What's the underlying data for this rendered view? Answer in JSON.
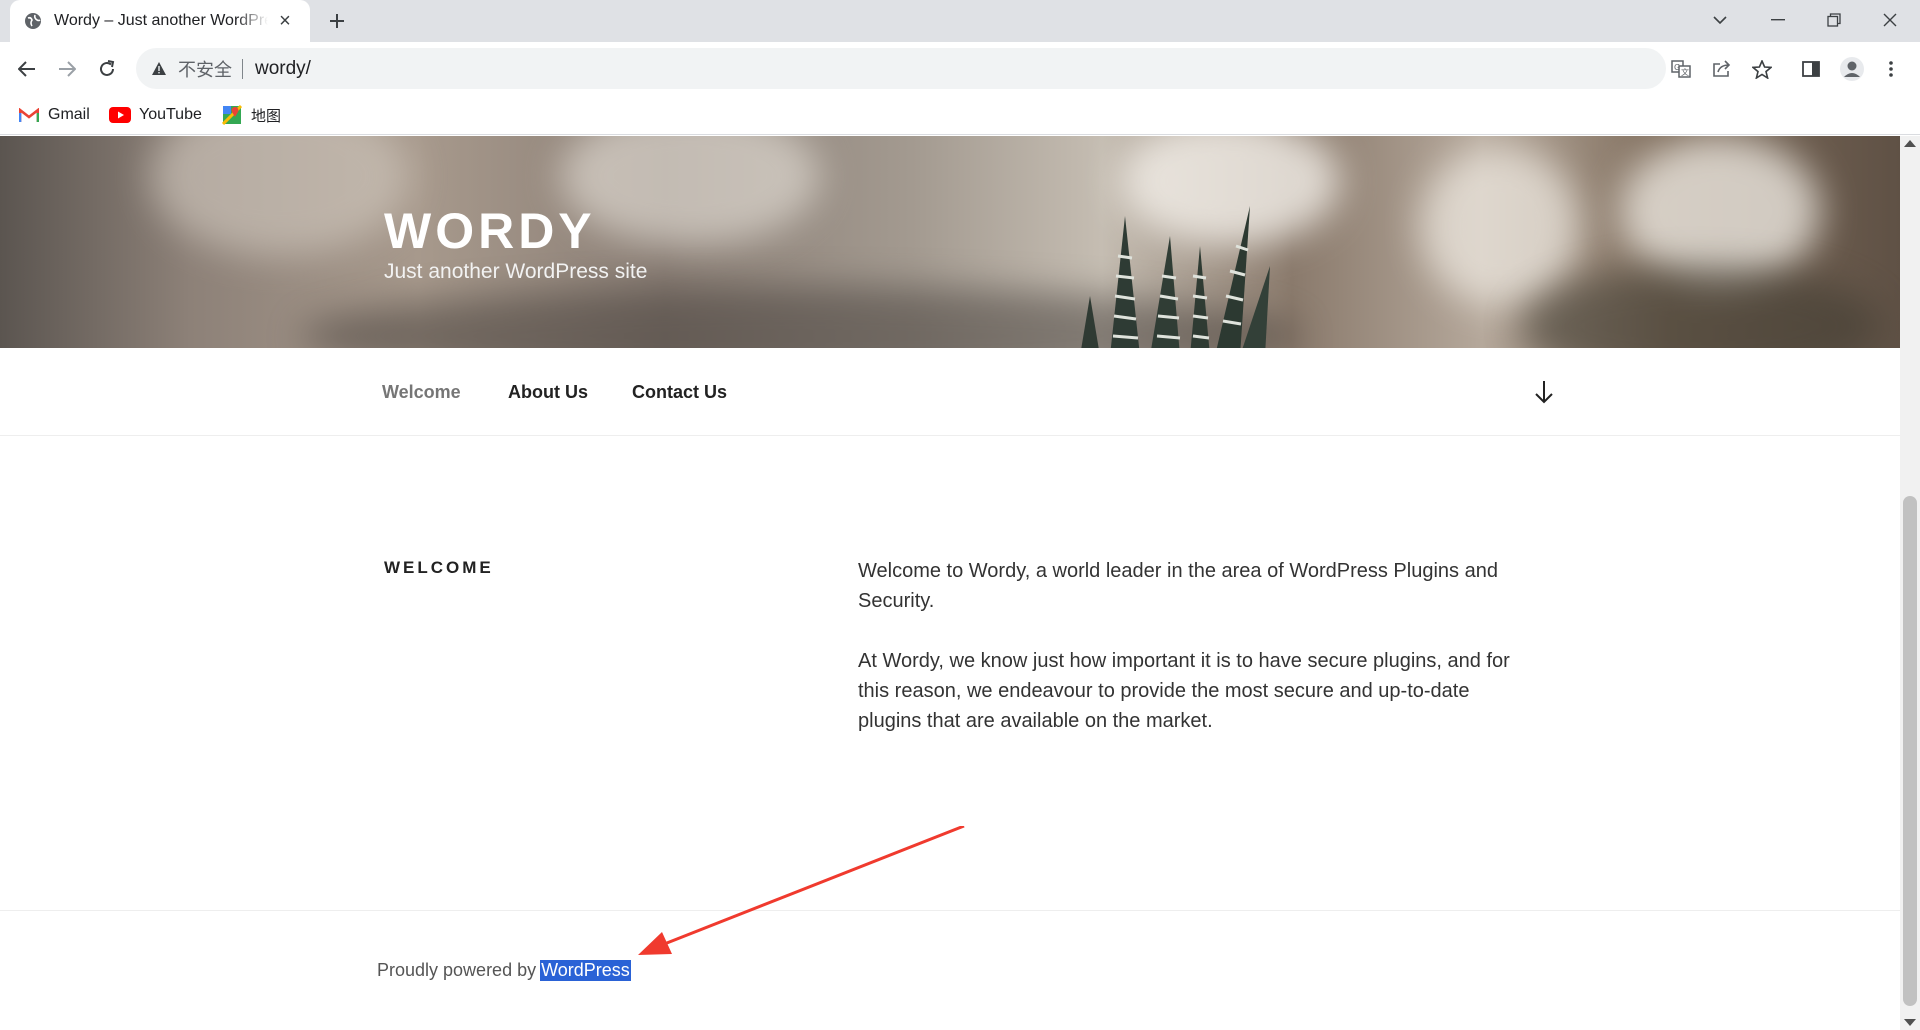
{
  "browser": {
    "tab_title": "Wordy – Just another WordPress site",
    "address_insecure_label": "不安全",
    "address_url": "wordy/",
    "bookmarks": [
      {
        "label": "Gmail",
        "icon": "gmail-icon"
      },
      {
        "label": "YouTube",
        "icon": "youtube-icon"
      },
      {
        "label": "地图",
        "icon": "maps-icon"
      }
    ]
  },
  "site": {
    "title": "WORDY",
    "description": "Just another WordPress site"
  },
  "nav": {
    "items": [
      {
        "label": "Welcome",
        "current": true
      },
      {
        "label": "About Us",
        "current": false
      },
      {
        "label": "Contact Us",
        "current": false
      }
    ],
    "scroll_icon": "arrow-down-icon"
  },
  "content": {
    "heading": "WELCOME",
    "paragraphs": [
      "Welcome to Wordy, a world leader in the area of WordPress Plugins and Security.",
      "At Wordy, we know just how important it is to have secure plugins, and for this reason, we endeavour to provide the most secure and up-to-date plugins that are available on the market."
    ]
  },
  "footer": {
    "credit_prefix": "Proudly powered by",
    "credit_link": "WordPress"
  },
  "colors": {
    "selection_highlight": "#2a62d6",
    "annotation_arrow": "#f03a2e"
  }
}
